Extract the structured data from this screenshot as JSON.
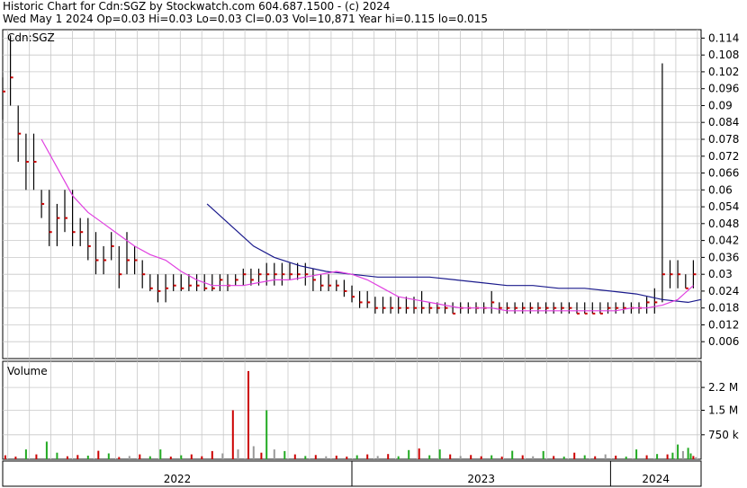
{
  "header": {
    "line1": "Historic Chart for Cdn:SGZ by Stockwatch.com 604.687.1500 - (c) 2024",
    "line2": "Wed May  1 2024  Op=0.03  Hi=0.03  Lo=0.03  Cl=0.03  Vol=10,871  Year hi=0.115  lo=0.015"
  },
  "colors": {
    "price_bar": "#000000",
    "close_tick": "#cc0000",
    "ma_short": "#e040e0",
    "ma_long": "#1a1a8c",
    "volume_up": "#22aa22",
    "volume_down": "#cc0000",
    "volume_neutral": "#999999",
    "grid": "#c8c8c8"
  },
  "chart_data": [
    {
      "type": "line",
      "title": "Cdn:SGZ",
      "xlabel": "",
      "ylabel": "",
      "x_range": [
        2021.65,
        2024.35
      ],
      "ylim": [
        0.0,
        0.117
      ],
      "y_ticks": [
        "0.006",
        "0.012",
        "0.018",
        "0.024",
        "0.03",
        "0.036",
        "0.042",
        "0.048",
        "0.054",
        "0.06",
        "0.066",
        "0.072",
        "0.078",
        "0.084",
        "0.09",
        "0.096",
        "0.102",
        "0.108",
        "0.114"
      ],
      "x_ticks": [
        "2022",
        "2023",
        "2024"
      ],
      "x_tick_positions": [
        2022.0,
        2023.0,
        2024.0
      ],
      "grid": true,
      "series": [
        {
          "kind": "hlc_bars",
          "x": [
            2021.65,
            2021.68,
            2021.71,
            2021.74,
            2021.77,
            2021.8,
            2021.83,
            2021.86,
            2021.89,
            2021.92,
            2021.95,
            2021.98,
            2022.01,
            2022.04,
            2022.07,
            2022.1,
            2022.13,
            2022.16,
            2022.19,
            2022.22,
            2022.25,
            2022.28,
            2022.31,
            2022.34,
            2022.37,
            2022.4,
            2022.43,
            2022.46,
            2022.49,
            2022.52,
            2022.55,
            2022.58,
            2022.61,
            2022.64,
            2022.67,
            2022.7,
            2022.73,
            2022.76,
            2022.79,
            2022.82,
            2022.85,
            2022.88,
            2022.91,
            2022.94,
            2022.97,
            2023.0,
            2023.03,
            2023.06,
            2023.09,
            2023.12,
            2023.15,
            2023.18,
            2023.21,
            2023.24,
            2023.27,
            2023.3,
            2023.33,
            2023.36,
            2023.39,
            2023.42,
            2023.45,
            2023.48,
            2023.51,
            2023.54,
            2023.57,
            2023.6,
            2023.63,
            2023.66,
            2023.69,
            2023.72,
            2023.75,
            2023.78,
            2023.81,
            2023.84,
            2023.87,
            2023.9,
            2023.93,
            2023.96,
            2023.99,
            2024.02,
            2024.05,
            2024.08,
            2024.11,
            2024.14,
            2024.17,
            2024.2,
            2024.23,
            2024.26,
            2024.29,
            2024.32
          ],
          "high": [
            0.1,
            0.115,
            0.09,
            0.08,
            0.08,
            0.06,
            0.06,
            0.055,
            0.06,
            0.06,
            0.05,
            0.05,
            0.045,
            0.04,
            0.045,
            0.04,
            0.045,
            0.04,
            0.035,
            0.03,
            0.03,
            0.03,
            0.03,
            0.03,
            0.03,
            0.03,
            0.03,
            0.03,
            0.03,
            0.03,
            0.03,
            0.032,
            0.032,
            0.032,
            0.034,
            0.034,
            0.034,
            0.034,
            0.034,
            0.034,
            0.032,
            0.03,
            0.03,
            0.028,
            0.028,
            0.026,
            0.024,
            0.024,
            0.022,
            0.022,
            0.022,
            0.022,
            0.022,
            0.022,
            0.024,
            0.02,
            0.02,
            0.02,
            0.02,
            0.02,
            0.02,
            0.02,
            0.02,
            0.024,
            0.02,
            0.02,
            0.02,
            0.02,
            0.02,
            0.02,
            0.02,
            0.02,
            0.02,
            0.02,
            0.02,
            0.02,
            0.02,
            0.02,
            0.02,
            0.02,
            0.02,
            0.02,
            0.02,
            0.022,
            0.025,
            0.105,
            0.035,
            0.035,
            0.03,
            0.035
          ],
          "low": [
            0.085,
            0.09,
            0.07,
            0.06,
            0.06,
            0.05,
            0.04,
            0.04,
            0.045,
            0.04,
            0.04,
            0.035,
            0.03,
            0.03,
            0.035,
            0.025,
            0.03,
            0.03,
            0.025,
            0.024,
            0.02,
            0.02,
            0.024,
            0.024,
            0.024,
            0.024,
            0.024,
            0.024,
            0.024,
            0.024,
            0.026,
            0.026,
            0.026,
            0.026,
            0.026,
            0.026,
            0.026,
            0.028,
            0.028,
            0.026,
            0.024,
            0.024,
            0.024,
            0.024,
            0.022,
            0.02,
            0.018,
            0.018,
            0.016,
            0.016,
            0.016,
            0.016,
            0.016,
            0.016,
            0.016,
            0.016,
            0.016,
            0.016,
            0.016,
            0.016,
            0.016,
            0.016,
            0.016,
            0.016,
            0.016,
            0.016,
            0.016,
            0.016,
            0.016,
            0.016,
            0.016,
            0.016,
            0.016,
            0.016,
            0.016,
            0.016,
            0.016,
            0.016,
            0.016,
            0.016,
            0.016,
            0.016,
            0.016,
            0.016,
            0.016,
            0.02,
            0.025,
            0.025,
            0.025,
            0.025
          ],
          "close": [
            0.095,
            0.1,
            0.08,
            0.07,
            0.07,
            0.055,
            0.045,
            0.05,
            0.05,
            0.045,
            0.045,
            0.04,
            0.035,
            0.035,
            0.04,
            0.03,
            0.035,
            0.035,
            0.03,
            0.025,
            0.024,
            0.025,
            0.026,
            0.025,
            0.026,
            0.026,
            0.025,
            0.025,
            0.028,
            0.026,
            0.028,
            0.03,
            0.028,
            0.03,
            0.03,
            0.03,
            0.03,
            0.03,
            0.03,
            0.03,
            0.028,
            0.026,
            0.026,
            0.026,
            0.024,
            0.022,
            0.02,
            0.02,
            0.018,
            0.018,
            0.018,
            0.018,
            0.018,
            0.018,
            0.018,
            0.018,
            0.018,
            0.018,
            0.016,
            0.018,
            0.018,
            0.018,
            0.018,
            0.02,
            0.018,
            0.018,
            0.018,
            0.018,
            0.018,
            0.018,
            0.018,
            0.018,
            0.018,
            0.018,
            0.016,
            0.016,
            0.016,
            0.016,
            0.018,
            0.018,
            0.018,
            0.018,
            0.018,
            0.02,
            0.02,
            0.03,
            0.03,
            0.03,
            0.025,
            0.03
          ]
        },
        {
          "kind": "moving_average_short",
          "x": [
            2021.8,
            2021.86,
            2021.92,
            2021.98,
            2022.04,
            2022.1,
            2022.16,
            2022.22,
            2022.28,
            2022.34,
            2022.4,
            2022.46,
            2022.52,
            2022.58,
            2022.64,
            2022.7,
            2022.76,
            2022.82,
            2022.88,
            2022.94,
            2023.0,
            2023.06,
            2023.12,
            2023.18,
            2023.24,
            2023.3,
            2023.36,
            2023.42,
            2023.48,
            2023.54,
            2023.6,
            2023.66,
            2023.72,
            2023.78,
            2023.84,
            2023.9,
            2023.96,
            2024.02,
            2024.08,
            2024.14,
            2024.2,
            2024.26,
            2024.32
          ],
          "y": [
            0.078,
            0.068,
            0.058,
            0.052,
            0.048,
            0.044,
            0.04,
            0.037,
            0.035,
            0.031,
            0.028,
            0.026,
            0.026,
            0.026,
            0.027,
            0.028,
            0.028,
            0.029,
            0.03,
            0.031,
            0.03,
            0.028,
            0.025,
            0.022,
            0.021,
            0.02,
            0.019,
            0.018,
            0.018,
            0.018,
            0.017,
            0.017,
            0.017,
            0.017,
            0.017,
            0.017,
            0.017,
            0.017,
            0.018,
            0.018,
            0.019,
            0.021,
            0.026
          ]
        },
        {
          "kind": "moving_average_long",
          "x": [
            2022.44,
            2022.5,
            2022.56,
            2022.62,
            2022.7,
            2022.8,
            2022.9,
            2023.0,
            2023.1,
            2023.2,
            2023.3,
            2023.4,
            2023.5,
            2023.6,
            2023.7,
            2023.8,
            2023.9,
            2024.0,
            2024.1,
            2024.2,
            2024.3,
            2024.35
          ],
          "y": [
            0.055,
            0.05,
            0.045,
            0.04,
            0.036,
            0.033,
            0.031,
            0.03,
            0.029,
            0.029,
            0.029,
            0.028,
            0.027,
            0.026,
            0.026,
            0.025,
            0.025,
            0.024,
            0.023,
            0.021,
            0.02,
            0.021
          ]
        }
      ]
    },
    {
      "type": "bar",
      "title": "Volume",
      "xlabel": "",
      "ylabel": "",
      "ylim": [
        0,
        3000000
      ],
      "y_ticks": [
        "750 k",
        "1.5 M",
        "2.2 M"
      ],
      "y_tick_values": [
        750000,
        1500000,
        2200000
      ],
      "grid": true,
      "bars_sampled": [
        {
          "x": 2021.66,
          "v": 120000,
          "dir": "down"
        },
        {
          "x": 2021.7,
          "v": 80000,
          "dir": "down"
        },
        {
          "x": 2021.74,
          "v": 300000,
          "dir": "up"
        },
        {
          "x": 2021.78,
          "v": 150000,
          "dir": "down"
        },
        {
          "x": 2021.82,
          "v": 540000,
          "dir": "up"
        },
        {
          "x": 2021.86,
          "v": 200000,
          "dir": "up"
        },
        {
          "x": 2021.9,
          "v": 90000,
          "dir": "down"
        },
        {
          "x": 2021.94,
          "v": 130000,
          "dir": "down"
        },
        {
          "x": 2021.98,
          "v": 110000,
          "dir": "up"
        },
        {
          "x": 2022.02,
          "v": 260000,
          "dir": "down"
        },
        {
          "x": 2022.06,
          "v": 180000,
          "dir": "up"
        },
        {
          "x": 2022.1,
          "v": 70000,
          "dir": "down"
        },
        {
          "x": 2022.14,
          "v": 100000,
          "dir": "neutral"
        },
        {
          "x": 2022.18,
          "v": 150000,
          "dir": "down"
        },
        {
          "x": 2022.22,
          "v": 90000,
          "dir": "up"
        },
        {
          "x": 2022.26,
          "v": 300000,
          "dir": "up"
        },
        {
          "x": 2022.3,
          "v": 80000,
          "dir": "down"
        },
        {
          "x": 2022.34,
          "v": 120000,
          "dir": "up"
        },
        {
          "x": 2022.38,
          "v": 150000,
          "dir": "down"
        },
        {
          "x": 2022.42,
          "v": 90000,
          "dir": "down"
        },
        {
          "x": 2022.46,
          "v": 250000,
          "dir": "down"
        },
        {
          "x": 2022.5,
          "v": 180000,
          "dir": "neutral"
        },
        {
          "x": 2022.54,
          "v": 1500000,
          "dir": "down"
        },
        {
          "x": 2022.56,
          "v": 300000,
          "dir": "neutral"
        },
        {
          "x": 2022.6,
          "v": 2700000,
          "dir": "down"
        },
        {
          "x": 2022.62,
          "v": 400000,
          "dir": "neutral"
        },
        {
          "x": 2022.65,
          "v": 200000,
          "dir": "down"
        },
        {
          "x": 2022.67,
          "v": 1500000,
          "dir": "up"
        },
        {
          "x": 2022.7,
          "v": 300000,
          "dir": "neutral"
        },
        {
          "x": 2022.74,
          "v": 250000,
          "dir": "up"
        },
        {
          "x": 2022.78,
          "v": 150000,
          "dir": "down"
        },
        {
          "x": 2022.82,
          "v": 100000,
          "dir": "up"
        },
        {
          "x": 2022.86,
          "v": 130000,
          "dir": "down"
        },
        {
          "x": 2022.9,
          "v": 90000,
          "dir": "neutral"
        },
        {
          "x": 2022.94,
          "v": 110000,
          "dir": "down"
        },
        {
          "x": 2022.98,
          "v": 80000,
          "dir": "down"
        },
        {
          "x": 2023.02,
          "v": 120000,
          "dir": "up"
        },
        {
          "x": 2023.06,
          "v": 150000,
          "dir": "down"
        },
        {
          "x": 2023.1,
          "v": 100000,
          "dir": "neutral"
        },
        {
          "x": 2023.14,
          "v": 160000,
          "dir": "down"
        },
        {
          "x": 2023.18,
          "v": 90000,
          "dir": "up"
        },
        {
          "x": 2023.22,
          "v": 280000,
          "dir": "up"
        },
        {
          "x": 2023.26,
          "v": 330000,
          "dir": "down"
        },
        {
          "x": 2023.3,
          "v": 120000,
          "dir": "up"
        },
        {
          "x": 2023.34,
          "v": 300000,
          "dir": "up"
        },
        {
          "x": 2023.38,
          "v": 150000,
          "dir": "down"
        },
        {
          "x": 2023.42,
          "v": 100000,
          "dir": "neutral"
        },
        {
          "x": 2023.46,
          "v": 130000,
          "dir": "down"
        },
        {
          "x": 2023.5,
          "v": 90000,
          "dir": "down"
        },
        {
          "x": 2023.54,
          "v": 120000,
          "dir": "up"
        },
        {
          "x": 2023.58,
          "v": 80000,
          "dir": "down"
        },
        {
          "x": 2023.62,
          "v": 260000,
          "dir": "up"
        },
        {
          "x": 2023.66,
          "v": 120000,
          "dir": "down"
        },
        {
          "x": 2023.7,
          "v": 90000,
          "dir": "neutral"
        },
        {
          "x": 2023.74,
          "v": 250000,
          "dir": "up"
        },
        {
          "x": 2023.78,
          "v": 100000,
          "dir": "down"
        },
        {
          "x": 2023.82,
          "v": 80000,
          "dir": "up"
        },
        {
          "x": 2023.86,
          "v": 200000,
          "dir": "down"
        },
        {
          "x": 2023.9,
          "v": 120000,
          "dir": "up"
        },
        {
          "x": 2023.94,
          "v": 90000,
          "dir": "down"
        },
        {
          "x": 2023.98,
          "v": 150000,
          "dir": "neutral"
        },
        {
          "x": 2024.02,
          "v": 110000,
          "dir": "down"
        },
        {
          "x": 2024.06,
          "v": 80000,
          "dir": "up"
        },
        {
          "x": 2024.1,
          "v": 300000,
          "dir": "up"
        },
        {
          "x": 2024.14,
          "v": 120000,
          "dir": "down"
        },
        {
          "x": 2024.18,
          "v": 160000,
          "dir": "up"
        },
        {
          "x": 2024.22,
          "v": 150000,
          "dir": "down"
        },
        {
          "x": 2024.24,
          "v": 200000,
          "dir": "up"
        },
        {
          "x": 2024.26,
          "v": 450000,
          "dir": "up"
        },
        {
          "x": 2024.28,
          "v": 250000,
          "dir": "neutral"
        },
        {
          "x": 2024.3,
          "v": 350000,
          "dir": "up"
        },
        {
          "x": 2024.31,
          "v": 180000,
          "dir": "up"
        },
        {
          "x": 2024.32,
          "v": 100000,
          "dir": "down"
        },
        {
          "x": 2024.33,
          "v": 60000,
          "dir": "neutral"
        }
      ]
    }
  ]
}
